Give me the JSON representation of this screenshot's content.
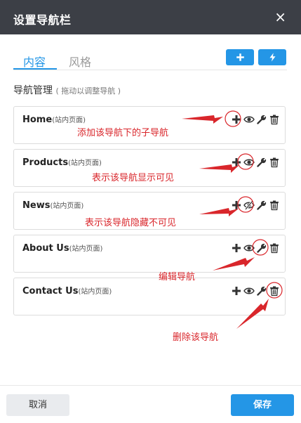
{
  "dialog": {
    "title": "设置导航栏",
    "close_icon": "×"
  },
  "tabs": [
    {
      "label": "内容",
      "active": true
    },
    {
      "label": "风格",
      "active": false
    }
  ],
  "toolbar": {
    "add_icon": "plus-icon",
    "quick_icon": "lightning-icon"
  },
  "section": {
    "title": "导航管理",
    "hint": "( 拖动以调整导航 )"
  },
  "nav_items": [
    {
      "name": "Home",
      "type": "(站内页面)",
      "visible": true
    },
    {
      "name": "Products",
      "type": "(站内页面)",
      "visible": true
    },
    {
      "name": "News",
      "type": "(站内页面)",
      "visible": false
    },
    {
      "name": "About Us",
      "type": "(站内页面)",
      "visible": true
    },
    {
      "name": "Contact Us",
      "type": "(站内页面)",
      "visible": true
    }
  ],
  "annotations": {
    "add": "添加该导航下的子导航",
    "show": "表示该导航显示可见",
    "hide": "表示该导航隐藏不可见",
    "edit": "编辑导航",
    "delete": "删除该导航"
  },
  "footer": {
    "cancel_label": "取消",
    "save_label": "保存"
  },
  "colors": {
    "accent": "#2496e6",
    "header": "#3c3f46",
    "annotation": "#d9262b"
  }
}
